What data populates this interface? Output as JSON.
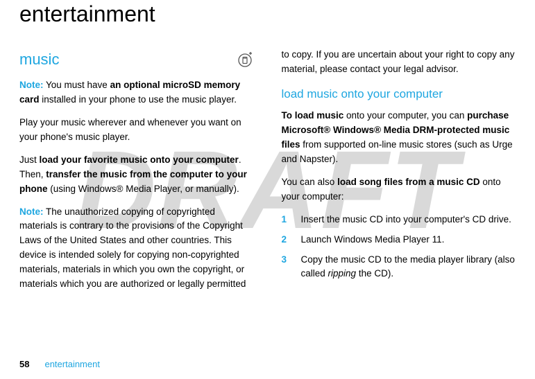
{
  "watermark": "DRAFT",
  "page_title": "entertainment",
  "left": {
    "heading": "music",
    "icon": "sd-card-icon",
    "p1_note": "Note:",
    "p1_a": " You must have ",
    "p1_b": "an optional microSD memory card",
    "p1_c": " installed in your phone to use the music player.",
    "p2": "Play your music wherever and whenever you want on your phone's music player.",
    "p3_a": "Just ",
    "p3_b": "load your favorite music onto your computer",
    "p3_c": ". Then, ",
    "p3_d": "transfer the music from the computer to your phone",
    "p3_e": " (using Windows® Media Player, or manually).",
    "p4_note": "Note:",
    "p4": " The unauthorized copying of copyrighted materials is contrary to the provisions of the Copyright Laws of the United States and other countries. This device is intended solely for copying non-copyrighted materials, materials in which you own the copyright, or materials which you are authorized or legally permitted"
  },
  "right": {
    "p1": "to copy. If you are uncertain about your right to copy any material, please contact your legal advisor.",
    "heading": "load music onto your computer",
    "p2_a": "To load music",
    "p2_b": " onto your computer, you can ",
    "p2_c": "purchase Microsoft® Windows® Media DRM-protected music files",
    "p2_d": " from supported on-line music stores (such as Urge and Napster).",
    "p3_a": "You can also ",
    "p3_b": "load song files from a music CD",
    "p3_c": " onto your computer:",
    "steps": [
      {
        "n": "1",
        "t": "Insert the music CD into your computer's CD drive."
      },
      {
        "n": "2",
        "t": "Launch Windows Media Player 11."
      },
      {
        "n": "3",
        "t_a": "Copy the music CD to the media player library (also called ",
        "t_b": "ripping",
        "t_c": " the CD)."
      }
    ]
  },
  "footer": {
    "page": "58",
    "text": "entertainment"
  }
}
